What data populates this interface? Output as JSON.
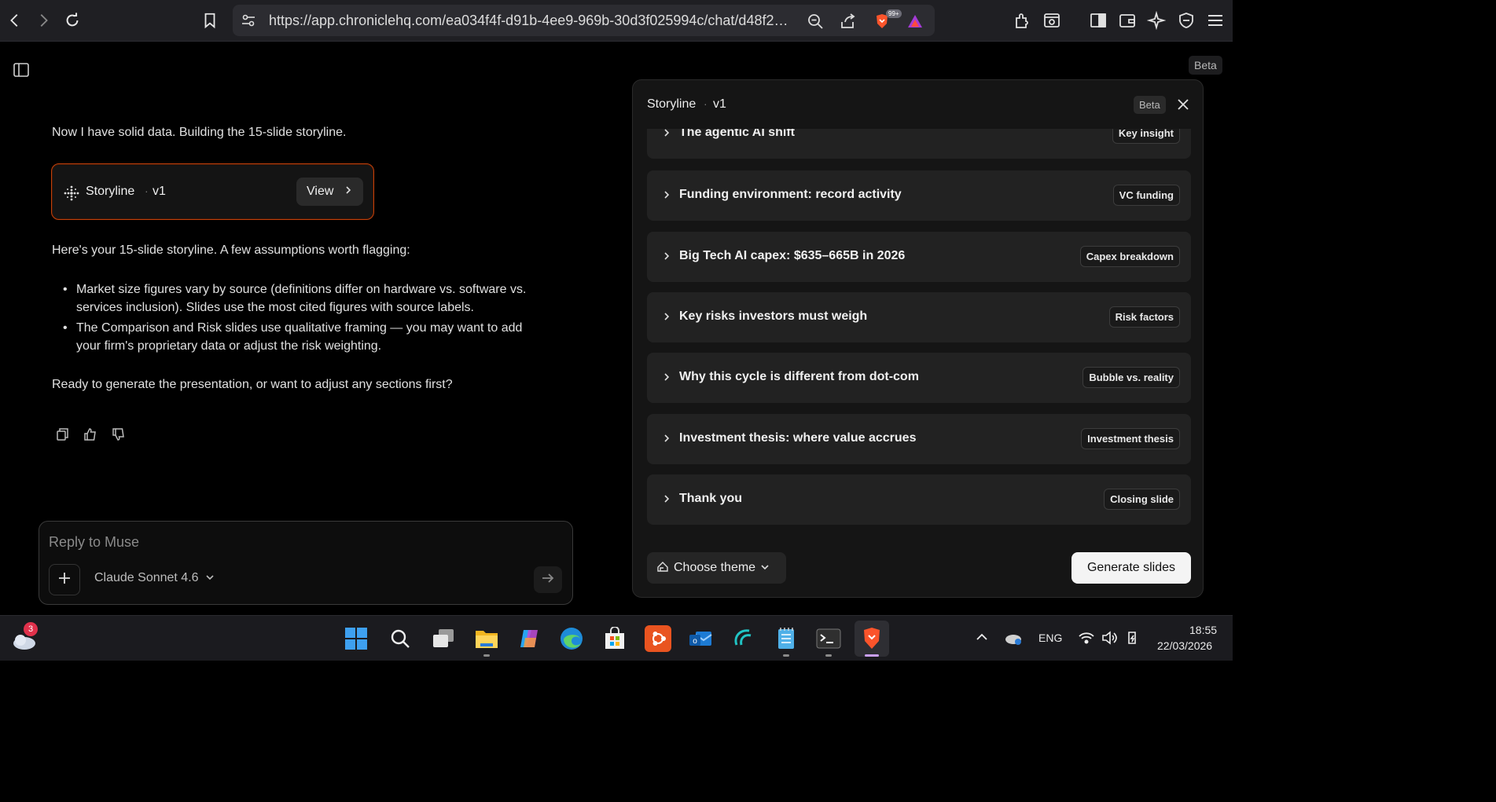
{
  "browser": {
    "url": "https://app.chroniclehq.com/ea034f4f-d91b-4ee9-969b-30d3f025994c/chat/d48f2935...",
    "brave_badge": "99+"
  },
  "top_beta": "Beta",
  "chat": {
    "intro": "Now I have solid data. Building the 15-slide storyline.",
    "card": {
      "title": "Storyline",
      "sep": "·",
      "version": "v1",
      "view_label": "View"
    },
    "summary": "Here's your 15-slide storyline. A few assumptions worth flagging:",
    "bullets": [
      "Market size figures vary by source (definitions differ on hardware vs. software vs. services inclusion). Slides use the most cited figures with source labels.",
      "The Comparison and Risk slides use qualitative framing — you may want to add your firm's proprietary data or adjust the risk weighting."
    ],
    "question": "Ready to generate the presentation, or want to adjust any sections first?"
  },
  "composer": {
    "placeholder": "Reply to Muse",
    "model": "Claude Sonnet 4.6"
  },
  "panel": {
    "title": "Storyline",
    "sep": "·",
    "version": "v1",
    "beta": "Beta",
    "slides": [
      {
        "title": "The agentic AI shift",
        "tag": "Key insight"
      },
      {
        "title": "Funding environment: record activity",
        "tag": "VC funding"
      },
      {
        "title": "Big Tech AI capex: $635–665B in 2026",
        "tag": "Capex breakdown"
      },
      {
        "title": "Key risks investors must weigh",
        "tag": "Risk factors"
      },
      {
        "title": "Why this cycle is different from dot-com",
        "tag": "Bubble vs. reality"
      },
      {
        "title": "Investment thesis: where value accrues",
        "tag": "Investment thesis"
      },
      {
        "title": "Thank you",
        "tag": "Closing slide"
      }
    ],
    "theme_label": "Choose theme",
    "generate_label": "Generate slides"
  },
  "taskbar": {
    "weather_badge": "3",
    "language": "ENG",
    "time": "18:55",
    "date": "22/03/2026"
  }
}
